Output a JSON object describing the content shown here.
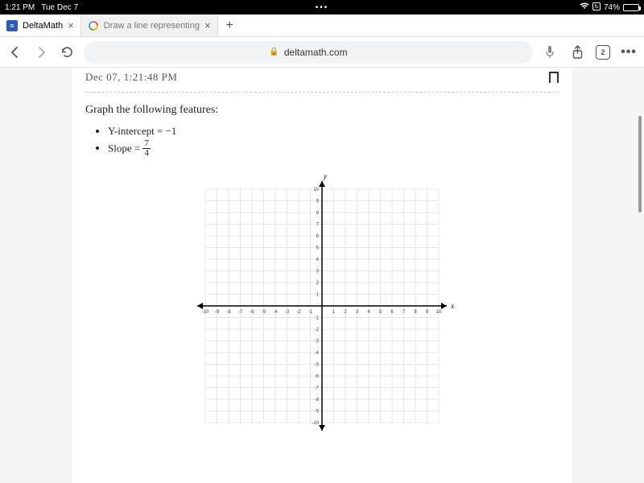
{
  "status": {
    "time": "1:21 PM",
    "date": "Tue Dec 7",
    "battery_pct": "74%",
    "center_dots": "•••"
  },
  "tabs": {
    "active": {
      "title": "DeltaMath"
    },
    "inactive": {
      "title": "Draw a line representing",
      "favicon": "G"
    },
    "count": "2"
  },
  "url": {
    "host": "deltamath.com"
  },
  "page": {
    "timestamp": "Dec 07, 1:21:48 PM",
    "prompt": "Graph the following features:",
    "bullet1_label": "Y-intercept = ",
    "bullet1_value": "−1",
    "bullet2_label": "Slope = ",
    "frac_num": "7",
    "frac_den": "4"
  },
  "chart_data": {
    "type": "scatter",
    "title": "",
    "xlabel": "x",
    "ylabel": "y",
    "xlim": [
      -10,
      10
    ],
    "ylim": [
      -10,
      10
    ],
    "x_ticks": [
      -10,
      -9,
      -8,
      -7,
      -6,
      -5,
      -4,
      -3,
      -2,
      -1,
      1,
      2,
      3,
      4,
      5,
      6,
      7,
      8,
      9,
      10
    ],
    "y_ticks": [
      -10,
      -9,
      -8,
      -7,
      -6,
      -5,
      -4,
      -3,
      -2,
      -1,
      1,
      2,
      3,
      4,
      5,
      6,
      7,
      8,
      9,
      10
    ],
    "grid": true,
    "series": []
  }
}
